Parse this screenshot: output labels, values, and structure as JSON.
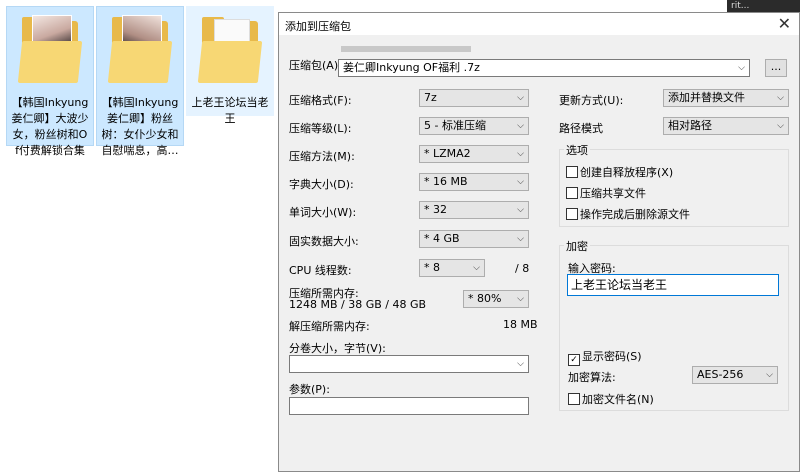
{
  "desktop": {
    "files": [
      {
        "name": "【韩国Inkyung姜仁卿】大波少女，粉丝树和Of付费解锁合集",
        "type": "folder-photo"
      },
      {
        "name": "【韩国Inkyung姜仁卿】粉丝树：女仆少女和自慰喘息，高…",
        "type": "folder-photo"
      },
      {
        "name": "上老王论坛当老王",
        "type": "folder-plain"
      }
    ]
  },
  "corner_text": "rit...",
  "dialog": {
    "title": "添加到压缩包",
    "close_label": "✕",
    "archive_label": "压缩包(A)",
    "archive_value": "姜仁卿Inkyung OF福利 .7z",
    "browse_label": "...",
    "left": {
      "format_label": "压缩格式(F):",
      "format_value": "7z",
      "level_label": "压缩等级(L):",
      "level_value": "5 - 标准压缩",
      "method_label": "压缩方法(M):",
      "method_value": "* LZMA2",
      "dict_label": "字典大小(D):",
      "dict_value": "* 16 MB",
      "word_label": "单词大小(W):",
      "word_value": "* 32",
      "solid_label": "固实数据大小:",
      "solid_value": "* 4 GB",
      "threads_label": "CPU 线程数:",
      "threads_value": "* 8",
      "threads_total": "/ 8",
      "mem_label": "压缩所需内存:",
      "mem_detail": "1248 MB / 38 GB / 48 GB",
      "mem_value": "* 80%",
      "decomp_label": "解压缩所需内存:",
      "decomp_value": "18 MB",
      "split_label": "分卷大小，字节(V):",
      "split_value": "",
      "params_label": "参数(P):",
      "params_value": ""
    },
    "right": {
      "update_label": "更新方式(U):",
      "update_value": "添加并替换文件",
      "path_label": "路径模式",
      "path_value": "相对路径",
      "options_title": "选项",
      "opt_sfx": "创建自释放程序(X)",
      "opt_shared": "压缩共享文件",
      "opt_delete": "操作完成后删除源文件",
      "encrypt_title": "加密",
      "pwd_label": "输入密码:",
      "pwd_value": "上老王论坛当老王",
      "show_pwd": "显示密码(S)",
      "algo_label": "加密算法:",
      "algo_value": "AES-256",
      "encrypt_names": "加密文件名(N)"
    }
  }
}
